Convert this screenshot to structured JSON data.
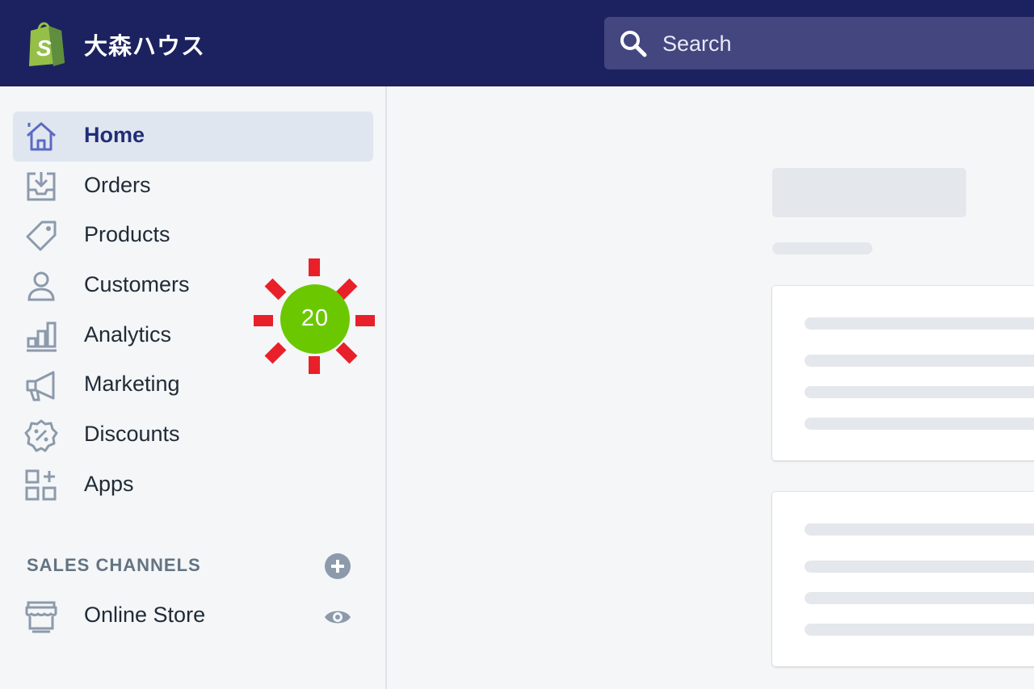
{
  "header": {
    "store_name": "大森ハウス",
    "logo_icon": "shopify-bag-icon",
    "search": {
      "placeholder": "Search",
      "icon": "search-icon"
    }
  },
  "sidebar": {
    "items": [
      {
        "label": "Home",
        "icon": "home-icon",
        "active": true
      },
      {
        "label": "Orders",
        "icon": "inbox-download-icon"
      },
      {
        "label": "Products",
        "icon": "tag-icon"
      },
      {
        "label": "Customers",
        "icon": "person-icon"
      },
      {
        "label": "Analytics",
        "icon": "bar-chart-icon"
      },
      {
        "label": "Marketing",
        "icon": "megaphone-icon"
      },
      {
        "label": "Discounts",
        "icon": "discount-badge-icon"
      },
      {
        "label": "Apps",
        "icon": "apps-grid-icon"
      }
    ],
    "sales_channels": {
      "title": "SALES CHANNELS",
      "add_icon": "plus-circle-icon",
      "items": [
        {
          "label": "Online Store",
          "icon": "storefront-icon",
          "action_icon": "eye-icon"
        }
      ]
    }
  },
  "orders_badge": {
    "count": "20",
    "color": "#6bc800",
    "burst_color": "#e8202a"
  },
  "colors": {
    "topbar": "#1c2260",
    "search_bg": "#43467f",
    "active_bg": "#e0e6f0",
    "active_text": "#202e78",
    "icon": "#8c9aab",
    "active_icon": "#5c6ac4"
  }
}
